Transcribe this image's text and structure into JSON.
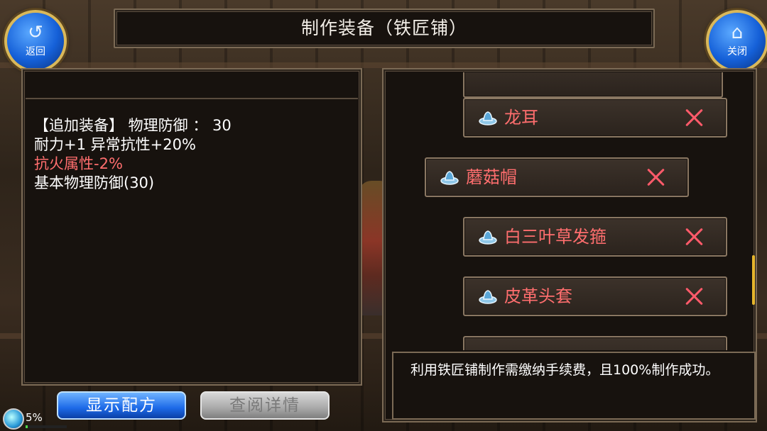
{
  "window": {
    "title": "制作装备（铁匠铺）"
  },
  "nav": {
    "back": {
      "label": "返回",
      "icon": "back-arrow-icon"
    },
    "close": {
      "label": "关闭",
      "icon": "home-icon"
    }
  },
  "info": {
    "lines": [
      {
        "text": "【追加装备】 物理防御 ：  30",
        "color": "#ffffff"
      },
      {
        "text": "耐力+1 异常抗性+20%",
        "color": "#ffffff"
      },
      {
        "text": "抗火属性-2%",
        "color": "#ff6e6e"
      },
      {
        "text": "基本物理防御(30)",
        "color": "#ffffff"
      }
    ]
  },
  "buttons": {
    "show_recipe": "显示配方",
    "view_details": "查阅详情"
  },
  "status": {
    "percent_label": "5%",
    "progress": 0.05
  },
  "items": [
    {
      "name": "龙耳",
      "icon": "hat-icon",
      "remove_icon": "close-x-icon"
    },
    {
      "name": "蘑菇帽",
      "icon": "hat-icon",
      "remove_icon": "close-x-icon"
    },
    {
      "name": "白三叶草发箍",
      "icon": "hat-icon",
      "remove_icon": "close-x-icon"
    },
    {
      "name": "皮革头套",
      "icon": "hat-icon",
      "remove_icon": "close-x-icon"
    }
  ],
  "description": "利用铁匠铺制作需缴纳手续费，且100%制作成功。",
  "colors": {
    "accent_red": "#ff6e6e",
    "button_blue": "#1d6ae8",
    "gold": "#d9b85a"
  }
}
